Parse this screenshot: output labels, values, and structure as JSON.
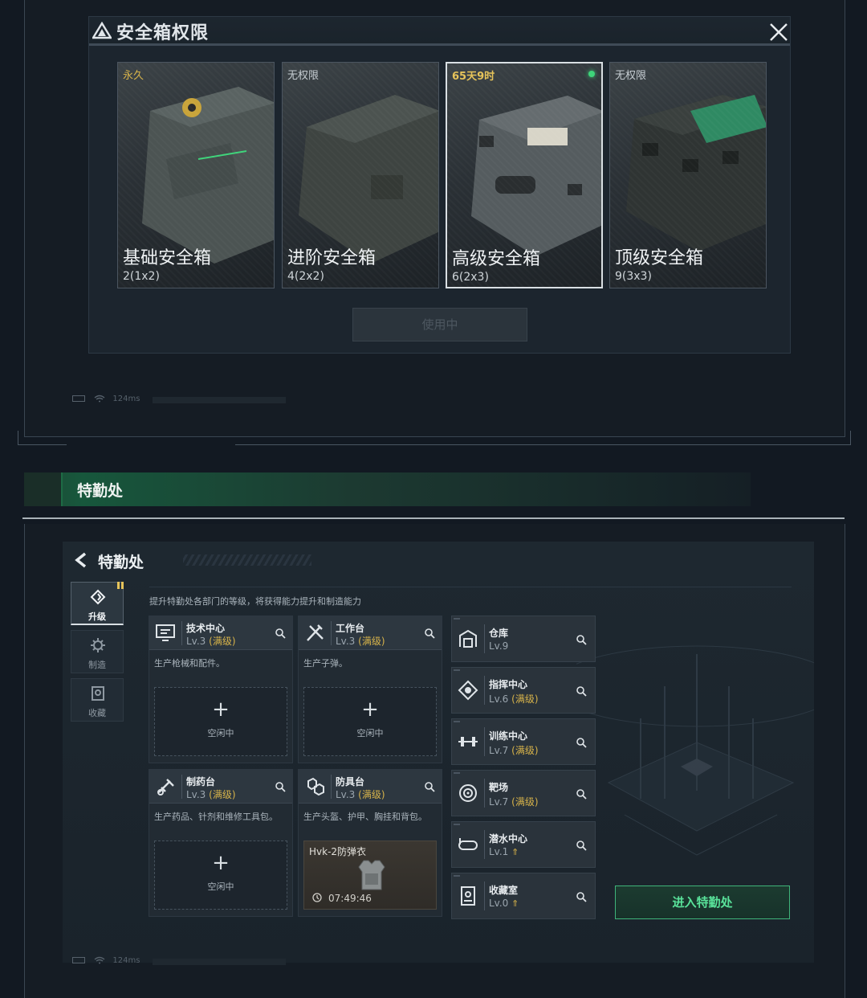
{
  "safebox": {
    "title": "安全箱权限",
    "cards": [
      {
        "tag": "永久",
        "name": "基础安全箱",
        "size": "2(1x2)"
      },
      {
        "tag": "无权限",
        "name": "进阶安全箱",
        "size": "4(2x2)"
      },
      {
        "tag": "65天9时",
        "name": "高级安全箱",
        "size": "6(2x3)"
      },
      {
        "tag": "无权限",
        "name": "顶级安全箱",
        "size": "9(3x3)"
      }
    ],
    "use_button": "使用中",
    "status": {
      "ping": "124ms"
    }
  },
  "section": {
    "title": "特勤处"
  },
  "hq": {
    "title": "特勤处",
    "tabs": [
      {
        "label": "升级"
      },
      {
        "label": "制造"
      },
      {
        "label": "收藏"
      }
    ],
    "description": "提升特勤处各部门的等级，将获得能力提升和制造能力",
    "facilities": [
      {
        "name": "技术中心",
        "level": "Lv.3",
        "max": "(满级)",
        "desc": "生产枪械和配件。",
        "slot_plus": "+",
        "slot_text": "空闲中"
      },
      {
        "name": "工作台",
        "level": "Lv.3",
        "max": "(满级)",
        "desc": "生产子弹。",
        "slot_plus": "+",
        "slot_text": "空闲中"
      },
      {
        "name": "制药台",
        "level": "Lv.3",
        "max": "(满级)",
        "desc": "生产药品、针剂和维修工具包。",
        "slot_plus": "+",
        "slot_text": "空闲中"
      },
      {
        "name": "防具台",
        "level": "Lv.3",
        "max": "(满级)",
        "desc": "生产头盔、护甲、胸挂和背包。",
        "craft_item": "Hvk-2防弹衣",
        "craft_timer": "07:49:46"
      }
    ],
    "list": [
      {
        "name": "仓库",
        "level": "Lv.9",
        "max": "",
        "icon": "warehouse-icon"
      },
      {
        "name": "指挥中心",
        "level": "Lv.6",
        "max": "(满级)",
        "icon": "command-icon"
      },
      {
        "name": "训练中心",
        "level": "Lv.7",
        "max": "(满级)",
        "icon": "dumbbell-icon"
      },
      {
        "name": "靶场",
        "level": "Lv.7",
        "max": "(满级)",
        "icon": "target-icon"
      },
      {
        "name": "潜水中心",
        "level": "Lv.1",
        "max": "",
        "up": "⇑",
        "icon": "dive-icon"
      },
      {
        "name": "收藏室",
        "level": "Lv.0",
        "max": "",
        "up": "⇑",
        "icon": "collection-icon"
      }
    ],
    "enter_button": "进入特勤处",
    "status": {
      "ping": "124ms"
    }
  },
  "colors": {
    "accent_green": "#59e29a",
    "max_gold": "#d7b34a",
    "active_dot": "#3ed47a"
  }
}
